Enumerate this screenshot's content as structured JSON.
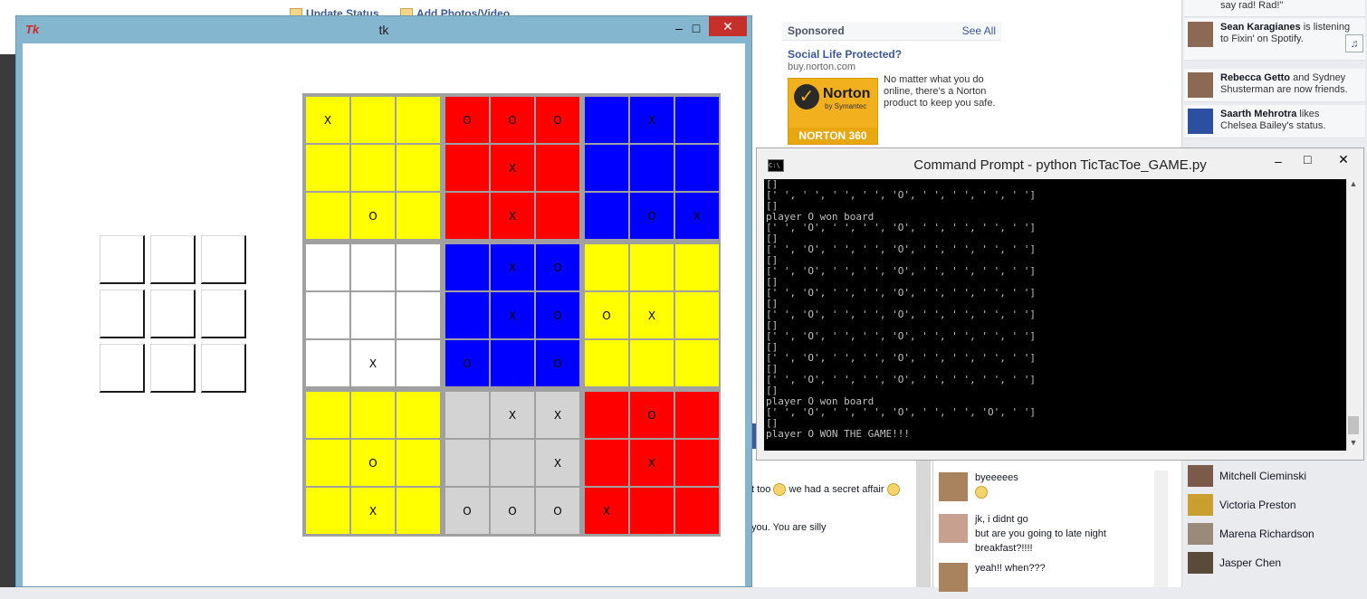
{
  "facebook": {
    "status_links": [
      "Update Status",
      "Add Photos/Video"
    ],
    "sponsored": {
      "heading": "Sponsored",
      "see_all": "See All",
      "ad_title": "Social Life Protected?",
      "ad_url": "buy.norton.com",
      "ad_text": "No matter what you do online, there's a Norton product to keep you safe.",
      "logo_word": "Norton",
      "logo_sub": "by Symantec",
      "logo_product": "NORTON 360"
    },
    "ticker": [
      {
        "text": "say rad! Rad!\""
      },
      {
        "name": "Sean Karagianes",
        "text": " is listening to Fixin' on Spotify."
      },
      {
        "name": "Rebecca Getto",
        "text": " and Sydney Shusterman are now friends."
      },
      {
        "name": "Saarth Mehrotra",
        "text": " likes Chelsea Bailey's status."
      }
    ],
    "chat_contacts": [
      "Mitchell Cieminski",
      "Victoria Preston",
      "Marena Richardson",
      "Jasper Chen"
    ],
    "messages": [
      {
        "line1": "byeeeees",
        "line2": ""
      },
      {
        "line1": "jk, i didnt go",
        "line2": "but are you going to late night breakfast?!!!!"
      },
      {
        "line1": "yeah!! when???",
        "line2": ""
      }
    ],
    "partial_msgs": [
      "t too",
      "we had a secret affair",
      "you. You are silly"
    ]
  },
  "tk_window": {
    "title": "tk",
    "logo": "Tk",
    "controls": {
      "minimize": "–",
      "maximize": "□",
      "close": "✕"
    },
    "big_board": [
      [
        "X",
        "",
        "",
        "O",
        "O",
        "O",
        "",
        "X",
        ""
      ],
      [
        "",
        "",
        "",
        "",
        "X",
        "",
        "",
        "",
        ""
      ],
      [
        "",
        "O",
        "",
        "",
        "X",
        "",
        "",
        "O",
        "X"
      ],
      [
        "",
        "",
        "",
        "",
        "X",
        "O",
        "",
        "",
        ""
      ],
      [
        "",
        "",
        "",
        "",
        "X",
        "O",
        "O",
        "X",
        ""
      ],
      [
        "",
        "X",
        "",
        "O",
        "",
        "O",
        "",
        "",
        ""
      ],
      [
        "",
        "",
        "",
        "",
        "X",
        "X",
        "",
        "O",
        ""
      ],
      [
        "",
        "O",
        "",
        "",
        "",
        "X",
        "",
        "X",
        ""
      ],
      [
        "",
        "X",
        "",
        "O",
        "O",
        "O",
        "X",
        "",
        ""
      ]
    ],
    "subboard_colors": [
      [
        "#ffff00",
        "#ff0000",
        "#0000ff"
      ],
      [
        "#ffffff",
        "#0000ff",
        "#ffff00"
      ],
      [
        "#ffff00",
        "#d3d3d3",
        "#ff0000"
      ]
    ]
  },
  "cmd_window": {
    "title": "Command Prompt - python  TicTacToe_GAME.py",
    "controls": {
      "minimize": "–",
      "maximize": "□",
      "close": "✕"
    },
    "lines": [
      "[]",
      "[' ', ' ', ' ', ' ', 'O', ' ', ' ', ' ', ' ']",
      "[]",
      "player O won board",
      "[' ', 'O', ' ', ' ', 'O', ' ', ' ', ' ', ' ']",
      "[]",
      "[' ', 'O', ' ', ' ', 'O', ' ', ' ', ' ', ' ']",
      "[]",
      "[' ', 'O', ' ', ' ', 'O', ' ', ' ', ' ', ' ']",
      "[]",
      "[' ', 'O', ' ', ' ', 'O', ' ', ' ', ' ', ' ']",
      "[]",
      "[' ', 'O', ' ', ' ', 'O', ' ', ' ', ' ', ' ']",
      "[]",
      "[' ', 'O', ' ', ' ', 'O', ' ', ' ', ' ', ' ']",
      "[]",
      "[' ', 'O', ' ', ' ', 'O', ' ', ' ', ' ', ' ']",
      "[]",
      "[' ', 'O', ' ', ' ', 'O', ' ', ' ', ' ', ' ']",
      "[]",
      "player O won board",
      "[' ', 'O', ' ', ' ', 'O', ' ', ' ', 'O', ' ']",
      "[]",
      "player O WON THE GAME!!!"
    ]
  }
}
